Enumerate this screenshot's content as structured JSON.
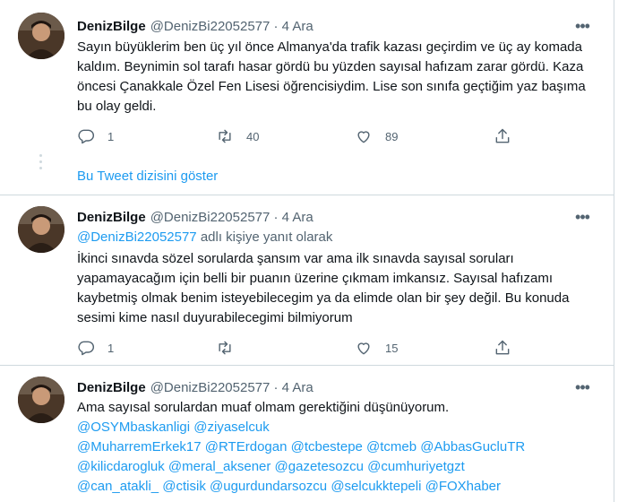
{
  "tweets": [
    {
      "name": "DenizBilge",
      "handle": "@DenizBi22052577 · 4 Ara",
      "text": "Sayın büyüklerim ben üç yıl önce Almanya'da trafik kazası geçirdim ve üç ay komada kaldım. Beynimin sol tarafı hasar gördü bu yüzden sayısal hafızam zarar gördü. Kaza öncesi Çanakkale Özel Fen Lisesi öğrencisiydim. Lise son sınıfa geçtiğim yaz başıma bu olay geldi.",
      "replies": "1",
      "retweets": "40",
      "likes": "89"
    },
    {
      "name": "DenizBilge",
      "handle": "@DenizBi22052577 · 4 Ara",
      "reply_mention": "@DenizBi22052577",
      "reply_suffix": " adlı kişiye yanıt olarak",
      "text": "İkinci sınavda sözel sorularda şansım var ama ilk sınavda sayısal soruları yapamayacağım için belli bir puanın üzerine çıkmam imkansız. Sayısal hafızamı kaybetmiş olmak benim isteyebilecegim ya da elimde olan bir şey değil. Bu konuda sesimi kime nasıl duyurabilecegimi bilmiyorum",
      "replies": "1",
      "retweets": "",
      "likes": "15"
    },
    {
      "name": "DenizBilge",
      "handle": "@DenizBi22052577 · 4 Ara",
      "text": "Ama sayısal sorulardan muaf olmam gerektiğini düşünüyorum.",
      "mentions_line1": "@OSYMbaskanligi @ziyaselcuk",
      "mentions_line2": "@MuharremErkek17 @RTErdogan @tcbestepe @tcmeb @AbbasGucluTR",
      "mentions_line3": "@kilicdarogluk @meral_aksener @gazetesozcu @cumhuriyetgzt",
      "mentions_line4": "@can_atakli_ @ctisik @ugurdundarsozcu @selcukktepeli @FOXhaber"
    }
  ],
  "show_thread": "Bu Tweet dizisini göster",
  "icons": {
    "more": "more-dots-icon",
    "reply": "reply-bubble-icon",
    "retweet": "retweet-icon",
    "like": "heart-icon",
    "share": "share-icon"
  },
  "colors": {
    "link": "#1d9bf0",
    "secondary_text": "#536471",
    "border": "#cfd9de"
  }
}
